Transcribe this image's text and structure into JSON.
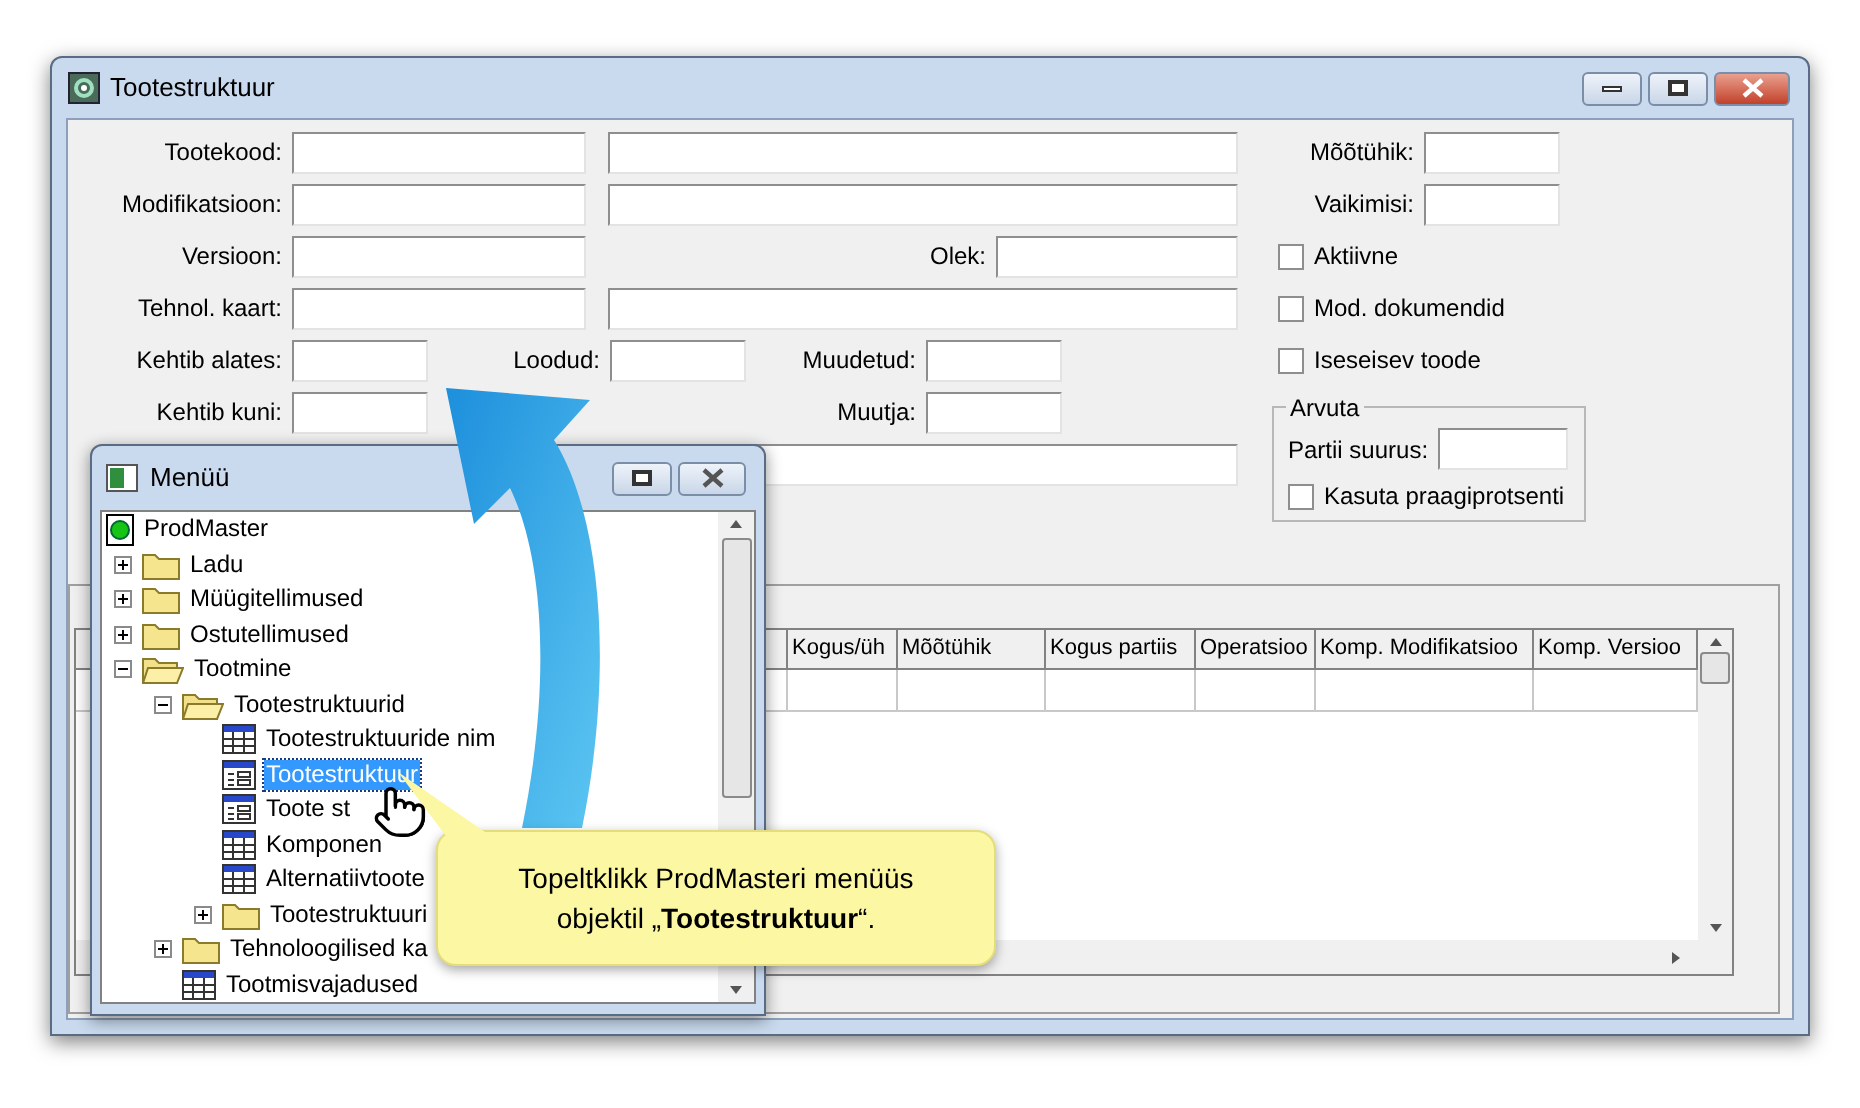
{
  "main_window": {
    "title": "Tootestruktuur"
  },
  "form": {
    "left_labels": [
      "Tootekood:",
      "Modifikatsioon:",
      "Versioon:",
      "Tehnol. kaart:",
      "Kehtib alates:",
      "Kehtib kuni:"
    ],
    "status_label": "Olek:",
    "created_label": "Loodud:",
    "modified_label": "Muudetud:",
    "modifier_label": "Muutja:",
    "unit_label": "Mõõtühik:",
    "default_label": "Vaikimisi:",
    "checkboxes": [
      {
        "label": "Aktiivne",
        "checked": false
      },
      {
        "label": "Mod. dokumendid",
        "checked": false
      },
      {
        "label": "Iseseisev toode",
        "checked": false
      }
    ],
    "calculate_group": {
      "title": "Arvuta",
      "batch_size_label": "Partii suurus:",
      "checkbox": {
        "label": "Kasuta praagiprotsenti",
        "checked": false
      }
    }
  },
  "table": {
    "columns": [
      "Kogus/üh",
      "Mõõtühik",
      "Kogus partiis",
      "Operatsioo",
      "Komp. Modifikatsioo",
      "Komp. Versioo"
    ]
  },
  "menu_window": {
    "title": "Menüü",
    "tree": [
      {
        "label": "ProdMaster",
        "kind": "root",
        "selected": false,
        "children": [
          {
            "label": "Ladu",
            "kind": "folder",
            "expanded": false,
            "selected": false
          },
          {
            "label": "Müügitellimused",
            "kind": "folder",
            "expanded": false,
            "selected": false
          },
          {
            "label": "Ostutellimused",
            "kind": "folder",
            "expanded": false,
            "selected": false
          },
          {
            "label": "Tootmine",
            "kind": "folder",
            "expanded": true,
            "selected": false,
            "children": [
              {
                "label": "Tootestruktuurid",
                "kind": "folder",
                "expanded": true,
                "selected": false,
                "children": [
                  {
                    "label": "Tootestruktuuride nim",
                    "kind": "grid",
                    "selected": false
                  },
                  {
                    "label": "Tootestruktuur",
                    "kind": "form",
                    "selected": true
                  },
                  {
                    "label": "Toote st",
                    "kind": "form",
                    "selected": false
                  },
                  {
                    "label": "Komponen",
                    "kind": "grid",
                    "selected": false
                  },
                  {
                    "label": "Alternatiivtoote",
                    "kind": "grid",
                    "selected": false
                  },
                  {
                    "label": "Tootestruktuuri",
                    "kind": "folder",
                    "expanded": false,
                    "selected": false
                  }
                ]
              },
              {
                "label": "Tehnoloogilised ka",
                "kind": "folder",
                "expanded": false,
                "selected": false
              },
              {
                "label": "Tootmisvajadused",
                "kind": "grid",
                "selected": false
              }
            ]
          }
        ]
      }
    ]
  },
  "callout": {
    "text": "Topeltklikk ProdMasteri menüüs objektil „**Tootestruktuur**“."
  }
}
